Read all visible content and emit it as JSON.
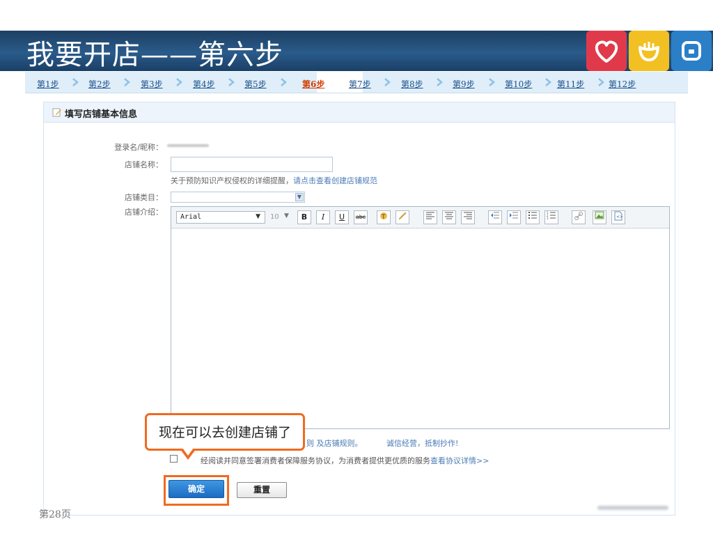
{
  "header": {
    "title": "我要开店——第六步",
    "logo_icons": [
      "heart-icon",
      "smile-icon",
      "square-icon"
    ],
    "colors": {
      "banner": "#1d3f63",
      "red_tile": "#e03a4a",
      "yellow_tile": "#f2c023",
      "blue_tile": "#2b7fc7"
    }
  },
  "steps": [
    {
      "label": "第1步"
    },
    {
      "label": "第2步"
    },
    {
      "label": "第3步"
    },
    {
      "label": "第4步"
    },
    {
      "label": "第5步"
    },
    {
      "label": "第6步",
      "active": true
    },
    {
      "label": "第7步"
    },
    {
      "label": "第8步"
    },
    {
      "label": "第9步"
    },
    {
      "label": "第10步"
    },
    {
      "label": "第11步"
    },
    {
      "label": "第12步"
    }
  ],
  "form": {
    "section_title": "填写店铺基本信息",
    "login_label": "登录名/昵称：",
    "shop_name_label": "店铺名称：",
    "shop_name_value": "",
    "ip_notice": "关于预防知识产权侵权的详细提醒，",
    "ip_link": "请点击查看创建店铺规范",
    "category_label": "店铺类目：",
    "category_value": "",
    "intro_label": "店铺介绍：",
    "editor": {
      "font": "Arial",
      "size": "10",
      "buttons": [
        "B",
        "I",
        "U",
        "abc"
      ]
    },
    "rules_tail": "则 及",
    "rules_link": "店铺规则。",
    "integrity": "诚信经营，抵制抄作!",
    "agree_text": "经阅读并同意签署消费者保障服务协议，为消费者提供更优质的服务",
    "agree_link": "查看协议详情>>",
    "confirm_label": "确定",
    "reset_label": "重置"
  },
  "callout": {
    "text": "现在可以去创建店铺了"
  },
  "footer": {
    "page": "第28页"
  }
}
